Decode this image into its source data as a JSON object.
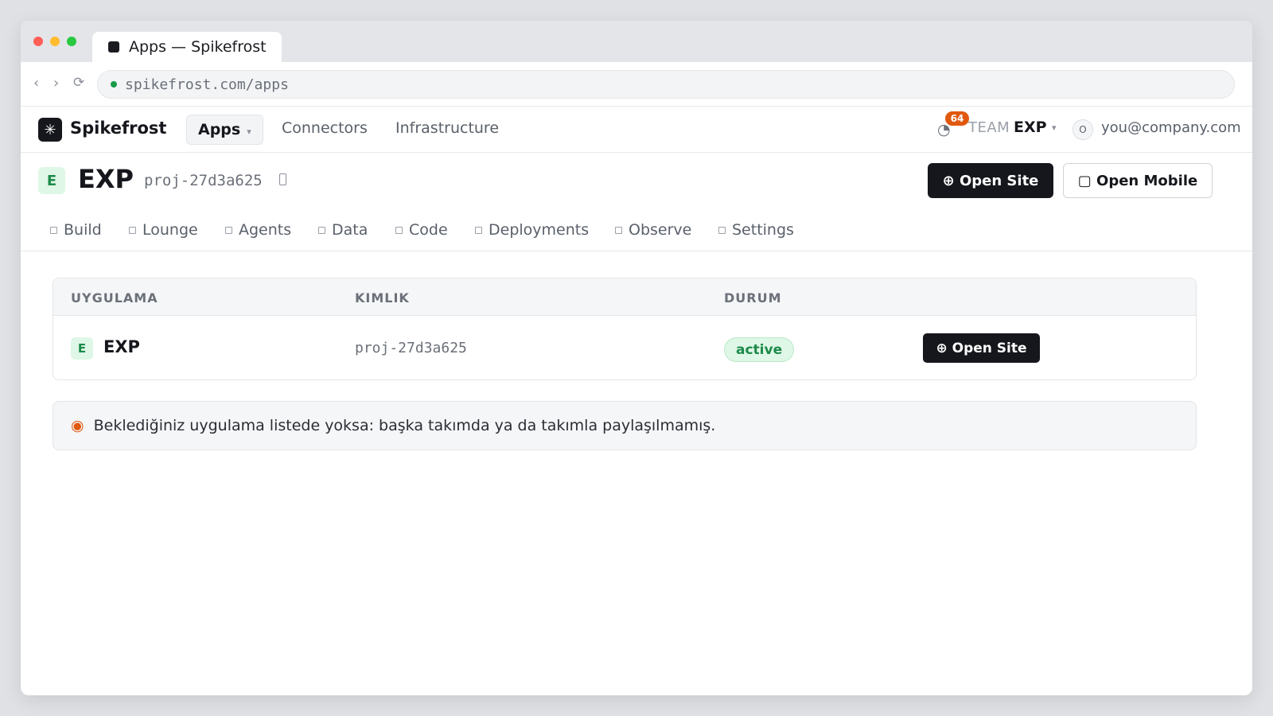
{
  "browser": {
    "tab_title": "Apps — Spikefrost",
    "url": "spikefrost.com/apps",
    "back_icon": "‹",
    "forward_icon": "›",
    "reload_icon": "⟳"
  },
  "header": {
    "logo_glyph": "✳",
    "brand": "Spikefrost",
    "nav": {
      "apps": "Apps",
      "connectors": "Connectors",
      "infrastructure": "Infrastructure"
    },
    "notifications_count": "64",
    "team_label": "TEAM",
    "team_name": "EXP",
    "avatar_initial": "O",
    "user_email": "you@company.com"
  },
  "project": {
    "badge": "E",
    "name": "EXP",
    "id": "proj-27d3a625",
    "open_site_label": "⊕ Open Site",
    "open_mobile_label": "▢ Open Mobile"
  },
  "subtabs": [
    "Build",
    "Lounge",
    "Agents",
    "Data",
    "Code",
    "Deployments",
    "Observe",
    "Settings"
  ],
  "table": {
    "headers": [
      "UYGULAMA",
      "KIMLIK",
      "DURUM"
    ],
    "rows": [
      {
        "badge": "E",
        "name": "EXP",
        "id": "proj-27d3a625",
        "status": "active",
        "action": "⊕ Open Site"
      }
    ]
  },
  "notice": {
    "icon": "◉",
    "text": "Beklediğiniz uygulama listede yoksa: başka takımda ya da takımla paylaşılmamış."
  },
  "colors": {
    "accent": "#16171c",
    "status_active": "#1d8a4a",
    "warning": "#e0590f"
  }
}
